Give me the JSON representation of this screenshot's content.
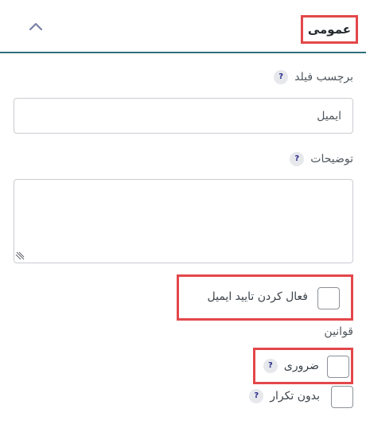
{
  "header": {
    "title": "عمومی",
    "collapse_icon": "chevron-up-icon",
    "divider_color": "#2f6f7d"
  },
  "fields": {
    "field_label": {
      "label": "برچسب فیلد",
      "help": "?",
      "value": "ایمیل"
    },
    "description": {
      "label": "توضیحات",
      "help": "?",
      "value": ""
    },
    "email_verification": {
      "label": "فعال کردن تایید ایمیل",
      "checked": false
    },
    "rules": {
      "label": "قوانین",
      "required": {
        "label": "ضروری",
        "help": "?",
        "checked": false
      },
      "no_duplicate": {
        "label": "بدون تکرار",
        "help": "?",
        "checked": false
      }
    }
  },
  "colors": {
    "highlight": "#e3474a",
    "help_badge_bg": "#e6e8ec",
    "help_badge_fg": "#2b2b8a"
  }
}
